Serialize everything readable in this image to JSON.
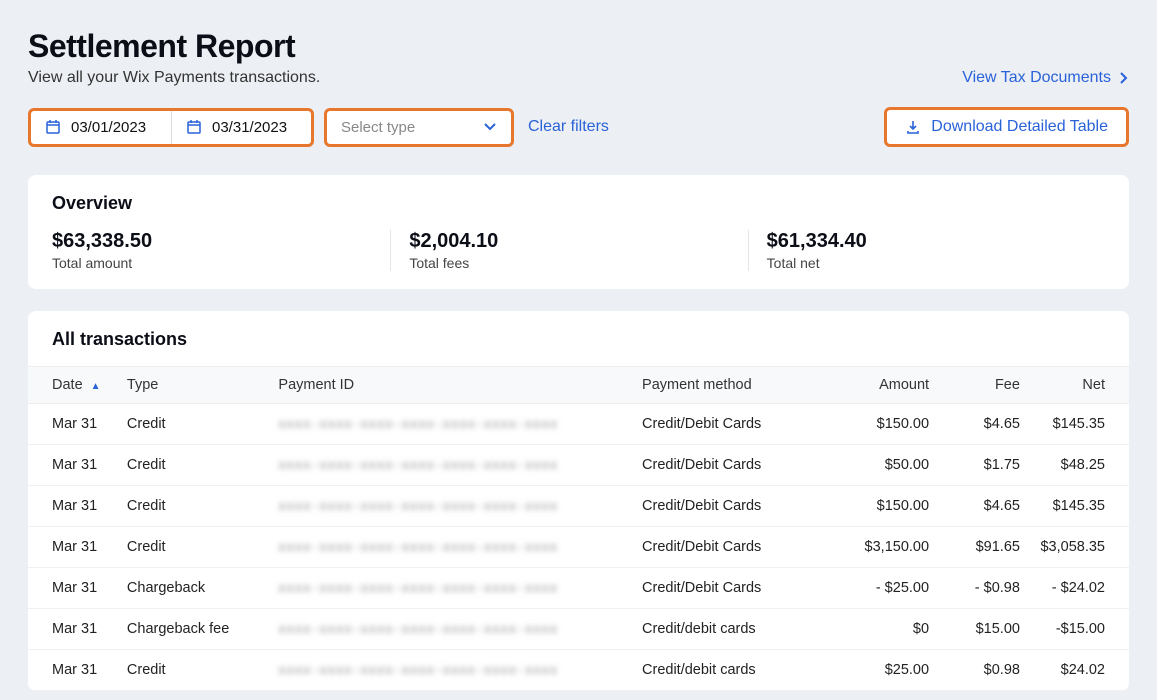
{
  "header": {
    "title": "Settlement Report",
    "subtitle": "View all your Wix Payments transactions.",
    "view_tax_label": "View Tax Documents"
  },
  "filters": {
    "date_from": "03/01/2023",
    "date_to": "03/31/2023",
    "type_placeholder": "Select type",
    "clear_label": "Clear filters"
  },
  "download": {
    "label": "Download Detailed Table"
  },
  "overview": {
    "heading": "Overview",
    "total_amount": {
      "value": "$63,338.50",
      "label": "Total amount"
    },
    "total_fees": {
      "value": "$2,004.10",
      "label": "Total fees"
    },
    "total_net": {
      "value": "$61,334.40",
      "label": "Total net"
    }
  },
  "transactions": {
    "heading": "All transactions",
    "columns": {
      "date": "Date",
      "type": "Type",
      "payment_id": "Payment ID",
      "payment_method": "Payment method",
      "amount": "Amount",
      "fee": "Fee",
      "net": "Net"
    },
    "rows": [
      {
        "date": "Mar 31",
        "type": "Credit",
        "method": "Credit/Debit Cards",
        "amount": "$150.00",
        "fee": "$4.65",
        "net": "$145.35"
      },
      {
        "date": "Mar 31",
        "type": "Credit",
        "method": "Credit/Debit Cards",
        "amount": "$50.00",
        "fee": "$1.75",
        "net": "$48.25"
      },
      {
        "date": "Mar 31",
        "type": "Credit",
        "method": "Credit/Debit Cards",
        "amount": "$150.00",
        "fee": "$4.65",
        "net": "$145.35"
      },
      {
        "date": "Mar 31",
        "type": "Credit",
        "method": "Credit/Debit Cards",
        "amount": "$3,150.00",
        "fee": "$91.65",
        "net": "$3,058.35"
      },
      {
        "date": "Mar 31",
        "type": "Chargeback",
        "method": "Credit/Debit Cards",
        "amount": "- $25.00",
        "fee": "- $0.98",
        "net": "- $24.02"
      },
      {
        "date": "Mar 31",
        "type": "Chargeback fee",
        "method": "Credit/debit cards",
        "amount": "$0",
        "fee": "$15.00",
        "net": "-$15.00"
      },
      {
        "date": "Mar 31",
        "type": "Credit",
        "method": "Credit/debit cards",
        "amount": "$25.00",
        "fee": "$0.98",
        "net": "$24.02"
      }
    ]
  }
}
